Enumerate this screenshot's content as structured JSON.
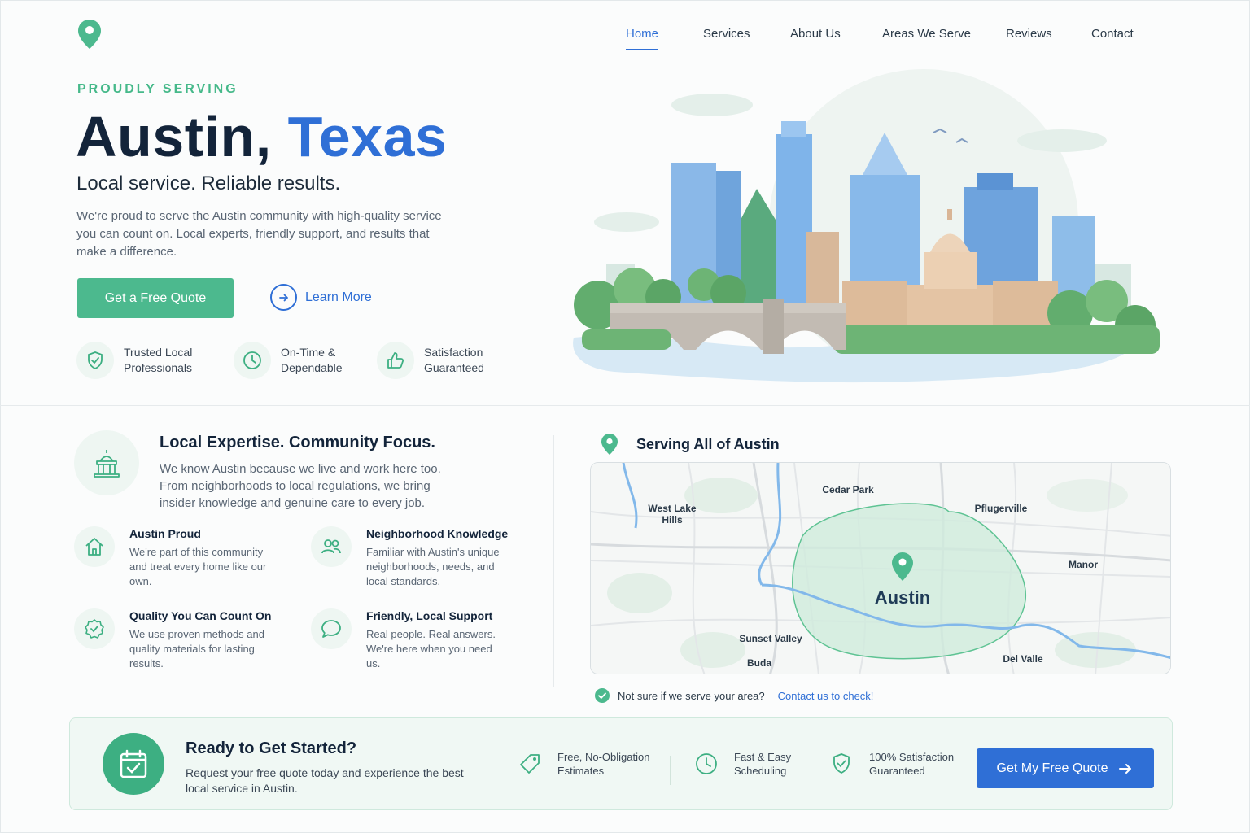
{
  "nav": {
    "items": [
      {
        "label": "Home",
        "active": true
      },
      {
        "label": "Services",
        "active": false
      },
      {
        "label": "About Us",
        "active": false
      },
      {
        "label": "Areas We Serve",
        "active": false
      },
      {
        "label": "Reviews",
        "active": false
      },
      {
        "label": "Contact",
        "active": false
      }
    ]
  },
  "hero": {
    "eyebrow": "PROUDLY SERVING",
    "title_city": "Austin,",
    "title_state": "Texas",
    "tagline": "Local service. Reliable results.",
    "description": "We're proud to serve the Austin community with high-quality service you can count on. Local experts, friendly support, and results that make a difference.",
    "primary_button": "Get a Free Quote",
    "secondary_button": "Learn More",
    "badges": [
      {
        "icon": "shield-check-icon",
        "label": "Trusted Local Professionals"
      },
      {
        "icon": "clock-icon",
        "label": "On-Time & Dependable"
      },
      {
        "icon": "thumbs-up-icon",
        "label": "Satisfaction Guaranteed"
      }
    ]
  },
  "expertise": {
    "title": "Local Expertise. Community Focus.",
    "description": "We know Austin because we live and work here too. From neighborhoods to local regulations, we bring insider knowledge and genuine care to every job.",
    "features": [
      {
        "icon": "home-icon",
        "title": "Austin Proud",
        "text": "We're part of this community and treat every home like our own."
      },
      {
        "icon": "users-icon",
        "title": "Neighborhood Knowledge",
        "text": "Familiar with Austin's unique neighborhoods, needs, and local standards."
      },
      {
        "icon": "badge-check-icon",
        "title": "Quality You Can Count On",
        "text": "We use proven methods and quality materials for lasting results."
      },
      {
        "icon": "chat-bubble-icon",
        "title": "Friendly, Local Support",
        "text": "Real people. Real answers. We're here when you need us."
      }
    ]
  },
  "map": {
    "title": "Serving All of Austin",
    "center_label": "Austin",
    "places": [
      "West Lake Hills",
      "Cedar Park",
      "Pflugerville",
      "Manor",
      "Sunset Valley",
      "Buda",
      "Del Valle"
    ],
    "note": "Not sure if we serve your area?",
    "note_link": "Contact us to check!"
  },
  "cta": {
    "title": "Ready to Get Started?",
    "description": "Request your free quote today and experience the best local service in Austin.",
    "features": [
      {
        "icon": "tag-icon",
        "label": "Free, No-Obligation Estimates"
      },
      {
        "icon": "clock-icon",
        "label": "Fast & Easy Scheduling"
      },
      {
        "icon": "shield-check-icon",
        "label": "100% Satisfaction Guaranteed"
      }
    ],
    "button": "Get My Free Quote"
  },
  "colors": {
    "green": "#4cb98e",
    "blue": "#2f6fd6",
    "navy": "#13243a",
    "muted": "#5a6674"
  }
}
